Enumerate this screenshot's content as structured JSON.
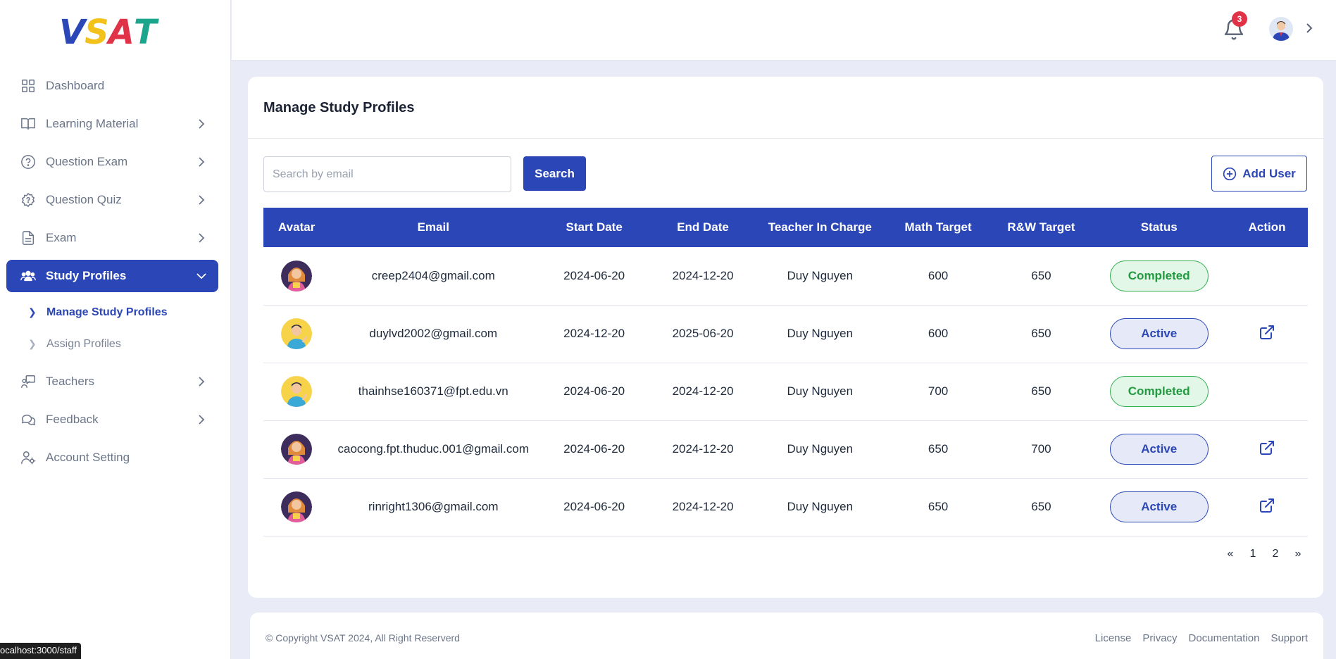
{
  "brand": {
    "logo": [
      "V",
      "S",
      "A",
      "T"
    ],
    "logo_colors": [
      "#2b46b6",
      "#f2c21b",
      "#e03347",
      "#1aa58c"
    ]
  },
  "sidebar": {
    "items": [
      {
        "label": "Dashboard",
        "icon": "grid-icon",
        "has_children": false
      },
      {
        "label": "Learning Material",
        "icon": "book-icon",
        "has_children": true
      },
      {
        "label": "Question Exam",
        "icon": "question-circle-icon",
        "has_children": true
      },
      {
        "label": "Question Quiz",
        "icon": "question-badge-icon",
        "has_children": true
      },
      {
        "label": "Exam",
        "icon": "document-icon",
        "has_children": true
      },
      {
        "label": "Study Profiles",
        "icon": "users-icon",
        "has_children": true,
        "active": true
      },
      {
        "label": "Teachers",
        "icon": "teacher-icon",
        "has_children": true
      },
      {
        "label": "Feedback",
        "icon": "chat-icon",
        "has_children": true
      },
      {
        "label": "Account Setting",
        "icon": "user-gear-icon",
        "has_children": false
      }
    ],
    "sub_items": [
      {
        "label": "Manage Study Profiles",
        "active": true
      },
      {
        "label": "Assign Profiles",
        "active": false
      }
    ]
  },
  "header": {
    "notification_count": "3"
  },
  "page": {
    "title": "Manage Study Profiles",
    "search_placeholder": "Search by email",
    "search_label": "Search",
    "add_user_label": "Add User"
  },
  "table": {
    "columns": [
      "Avatar",
      "Email",
      "Start Date",
      "End Date",
      "Teacher In Charge",
      "Math Target",
      "R&W Target",
      "Status",
      "Action"
    ],
    "rows": [
      {
        "email": "creep2404@gmail.com",
        "start": "2024-06-20",
        "end": "2024-12-20",
        "teacher": "Duy Nguyen",
        "math": "600",
        "rw": "650",
        "status": "Completed",
        "action": false,
        "avatar": "female-avatar"
      },
      {
        "email": "duylvd2002@gmail.com",
        "start": "2024-12-20",
        "end": "2025-06-20",
        "teacher": "Duy Nguyen",
        "math": "600",
        "rw": "650",
        "status": "Active",
        "action": true,
        "avatar": "male-avatar"
      },
      {
        "email": "thainhse160371@fpt.edu.vn",
        "start": "2024-06-20",
        "end": "2024-12-20",
        "teacher": "Duy Nguyen",
        "math": "700",
        "rw": "650",
        "status": "Completed",
        "action": false,
        "avatar": "male-avatar"
      },
      {
        "email": "caocong.fpt.thuduc.001@gmail.com",
        "start": "2024-06-20",
        "end": "2024-12-20",
        "teacher": "Duy Nguyen",
        "math": "650",
        "rw": "700",
        "status": "Active",
        "action": true,
        "avatar": "female-avatar"
      },
      {
        "email": "rinright1306@gmail.com",
        "start": "2024-06-20",
        "end": "2024-12-20",
        "teacher": "Duy Nguyen",
        "math": "650",
        "rw": "650",
        "status": "Active",
        "action": true,
        "avatar": "female-avatar"
      }
    ]
  },
  "pagination": {
    "prev": "«",
    "pages": [
      "1",
      "2"
    ],
    "next": "»"
  },
  "footer": {
    "copyright": "© Copyright VSAT 2024, All Right Reserverd",
    "links": [
      "License",
      "Privacy",
      "Documentation",
      "Support"
    ]
  },
  "status_bar": {
    "url": "ocalhost:3000/staff"
  },
  "colors": {
    "primary": "#2b46b6",
    "completed": "#229a3f",
    "badge": "#e03347"
  }
}
